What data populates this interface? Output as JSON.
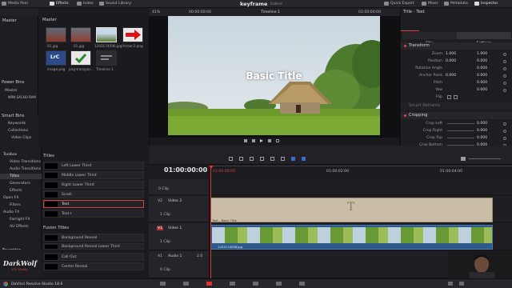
{
  "topbar": {
    "media_pool": "Media Pool",
    "effects": "Effects",
    "index": "Index",
    "sound_library": "Sound Library",
    "project_title": "keyframe",
    "edited": "Edited",
    "quick_export": "Quick Export",
    "mixer": "Mixer",
    "metadata": "Metadata",
    "inspector": "Inspector"
  },
  "media_pool": {
    "header": "Master",
    "bins_header": "Master",
    "power_bins": "Power Bins",
    "power_master": "Master",
    "power_item": "MRN SACHO RAM",
    "smart_bins": "Smart Bins",
    "smart_items": [
      "Keywords",
      "Collections",
      "Video Clips"
    ],
    "clips": [
      "01.jpg",
      "01.jpg",
      "1203174596.jpg",
      "Arrow-2.png",
      "image.png",
      "png-transpar...",
      "Timeline 1"
    ]
  },
  "viewer": {
    "zoom": "41%",
    "timecode_left": "00:00:00:00",
    "timeline_name": "Timeline 1",
    "timecode_right": "01:00:00:00",
    "overlay_text": "Basic Title"
  },
  "inspector": {
    "header": "Title - Text",
    "tabs": [
      "Video",
      "Audio",
      "Effects",
      "Transition",
      "Image",
      "File"
    ],
    "subtabs": [
      "Title",
      "Settings"
    ],
    "transform_label": "Transform",
    "zoom_label": "Zoom",
    "zoom_x": "1.000",
    "zoom_y": "1.000",
    "position_label": "Position",
    "position_x": "0.000",
    "position_y": "0.000",
    "rotation_label": "Rotation Angle",
    "rotation_value": "0.000",
    "anchor_label": "Anchor Point",
    "anchor_x": "0.000",
    "anchor_y": "0.000",
    "pitch_label": "Pitch",
    "pitch_value": "0.000",
    "yaw_label": "Yaw",
    "yaw_value": "0.000",
    "flip_label": "Flip",
    "smart_reframe": "Smart Reframe",
    "cropping_label": "Cropping",
    "crop_left": "Crop Left",
    "crop_left_v": "0.000",
    "crop_right": "Crop Right",
    "crop_right_v": "0.000",
    "crop_top": "Crop Top",
    "crop_top_v": "0.000",
    "crop_bottom": "Crop Bottom",
    "crop_bottom_v": "0.000",
    "softness": "Softness",
    "softness_v": "0.000"
  },
  "effects": {
    "toolbox": "Toolbox",
    "left_items": [
      "Video Transitions",
      "Audio Transitions",
      "Titles",
      "Generators",
      "Effects",
      "Open FX",
      "Filters",
      "Audio FX",
      "Fairlight FX",
      "AU Effects"
    ],
    "favorites": "Favorites",
    "titles_header": "Titles",
    "titles": [
      "Left Lower Third",
      "Middle Lower Third",
      "Right Lower Third",
      "Scroll",
      "Text",
      "Text+"
    ],
    "fusion_header": "Fusion Titles",
    "fusion": [
      "Background Reveal",
      "Background Reveal Lower Third",
      "Call Out",
      "Center Reveal"
    ]
  },
  "timeline": {
    "timecode": "01:00:00:00",
    "ruler": [
      "01:00:00:00",
      "01:00:02:00",
      "01:00:04:00"
    ],
    "v2_label": "V2",
    "v2_name": "Video 2",
    "v2_count": "1 Clip",
    "title_clip": "Text - Basic Title",
    "v1_label": "V1",
    "v1_name": "Video 1",
    "v1_count": "1 Clip",
    "video_clip": "1203174596.jpg",
    "a1_label": "A1",
    "a1_name": "Audio 1",
    "a1_level": "2.0",
    "a1_count": "0 Clip",
    "top_clip_count": "0 Clip"
  },
  "brand": {
    "app": "DaVinci Resolve Studio 18.6",
    "watermark1": "DarkWolf",
    "watermark2": "VFX Studio"
  }
}
